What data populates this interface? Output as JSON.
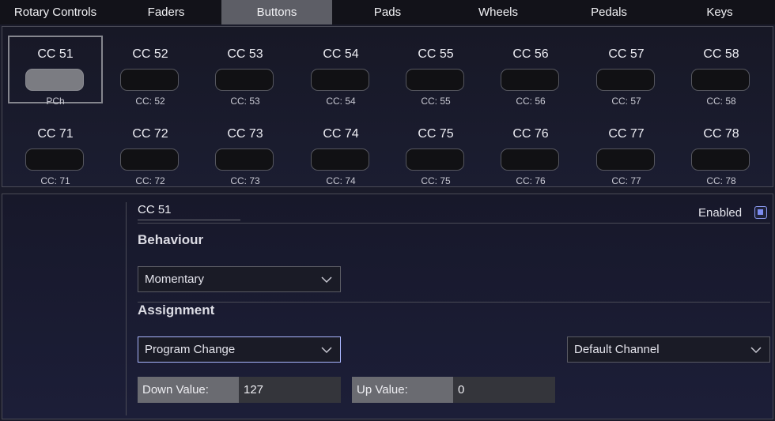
{
  "tabs": [
    {
      "label": "Rotary Controls",
      "active": false
    },
    {
      "label": "Faders",
      "active": false
    },
    {
      "label": "Buttons",
      "active": true
    },
    {
      "label": "Pads",
      "active": false
    },
    {
      "label": "Wheels",
      "active": false
    },
    {
      "label": "Pedals",
      "active": false
    },
    {
      "label": "Keys",
      "active": false
    }
  ],
  "buttons_grid": {
    "row1": [
      {
        "label": "CC 51",
        "sub": "PCh",
        "selected": true
      },
      {
        "label": "CC 52",
        "sub": "CC: 52"
      },
      {
        "label": "CC 53",
        "sub": "CC: 53"
      },
      {
        "label": "CC 54",
        "sub": "CC: 54"
      },
      {
        "label": "CC 55",
        "sub": "CC: 55"
      },
      {
        "label": "CC 56",
        "sub": "CC: 56"
      },
      {
        "label": "CC 57",
        "sub": "CC: 57"
      },
      {
        "label": "CC 58",
        "sub": "CC: 58"
      }
    ],
    "row2": [
      {
        "label": "CC 71",
        "sub": "CC: 71"
      },
      {
        "label": "CC 72",
        "sub": "CC: 72"
      },
      {
        "label": "CC 73",
        "sub": "CC: 73"
      },
      {
        "label": "CC 74",
        "sub": "CC: 74"
      },
      {
        "label": "CC 75",
        "sub": "CC: 75"
      },
      {
        "label": "CC 76",
        "sub": "CC: 76"
      },
      {
        "label": "CC 77",
        "sub": "CC: 77"
      },
      {
        "label": "CC 78",
        "sub": "CC: 78"
      }
    ]
  },
  "detail": {
    "name": "CC 51",
    "enabled_label": "Enabled",
    "enabled": true,
    "behaviour_title": "Behaviour",
    "behaviour_value": "Momentary",
    "assignment_title": "Assignment",
    "assignment_type": "Program Change",
    "channel": "Default Channel",
    "down_label": "Down Value:",
    "down_value": "127",
    "up_label": "Up Value:",
    "up_value": "0"
  },
  "colors": {
    "accent": "#7d8cf0",
    "active_tab": "#5d5e66",
    "focus_border": "#aab6ff"
  },
  "icons": {
    "dropdown": "chevron-down-icon"
  }
}
